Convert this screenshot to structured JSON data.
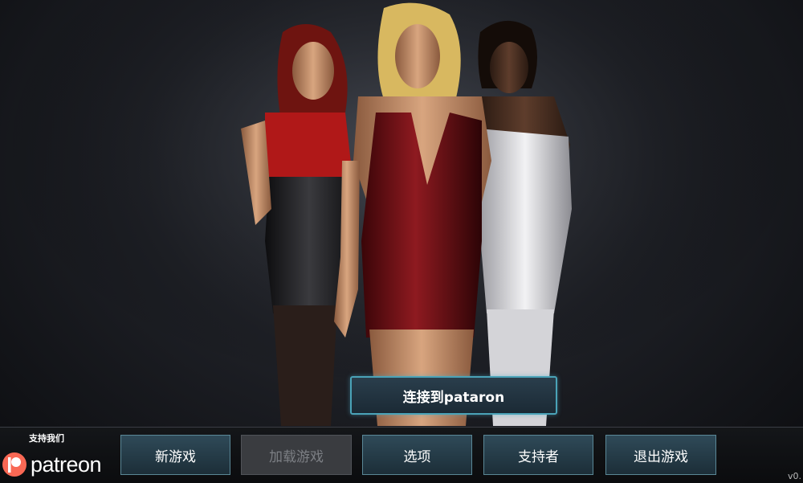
{
  "connect_button": {
    "label": "连接到pataron"
  },
  "menu": {
    "new_game": "新游戏",
    "load_game": "加载游戏",
    "options": "选项",
    "supporters": "支持者",
    "exit_game": "退出游戏"
  },
  "support": {
    "label": "支持我们",
    "logo_text": "patreon"
  },
  "version": "v0.",
  "colors": {
    "button_border": "#4aa3b8",
    "patreon_orange": "#f96854"
  }
}
